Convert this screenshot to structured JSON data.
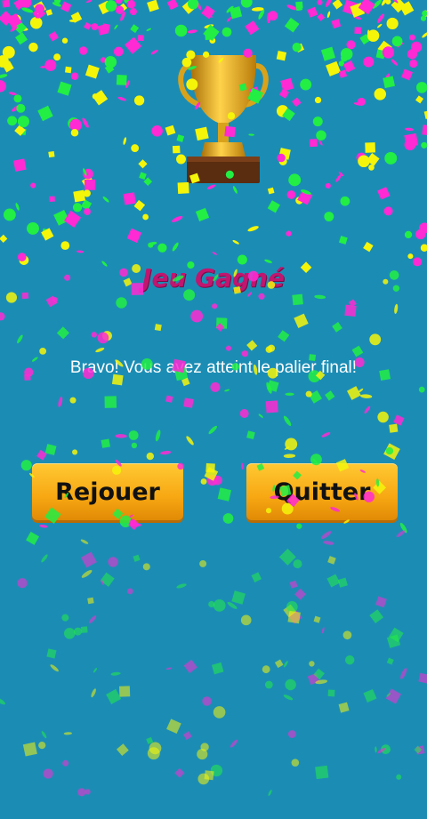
{
  "screen": {
    "title": "Jeu Gagné",
    "message": "Bravo! Vous avez atteint le palier final!",
    "background_color": "#1b8db5",
    "title_color": "#c0166f"
  },
  "buttons": {
    "replay_label": "Rejouer",
    "quit_label": "Quitter",
    "color": "#f7a712"
  },
  "decor": {
    "trophy_icon": "trophy-icon",
    "confetti_colors": [
      "#f5f50a",
      "#ff2ad4",
      "#22ee44"
    ]
  }
}
